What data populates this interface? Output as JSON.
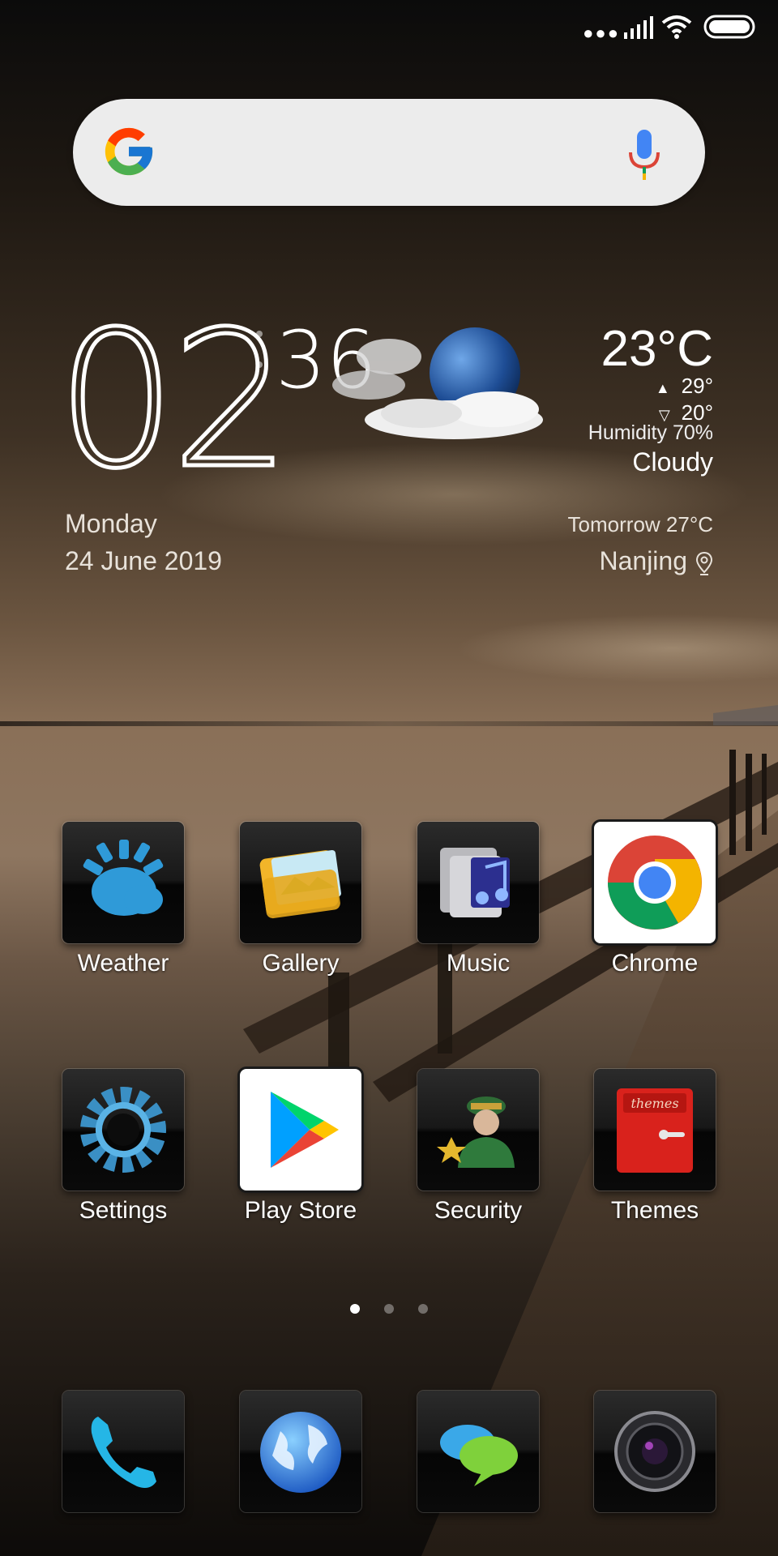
{
  "status_bar": {
    "icons": [
      "dots-icon",
      "signal-icon",
      "wifi-icon",
      "battery-icon"
    ]
  },
  "search": {
    "logo": "google-logo",
    "mic": "mic-icon"
  },
  "clock": {
    "hours": "02",
    "minutes": "36",
    "day": "Monday",
    "date": "24 June 2019"
  },
  "weather": {
    "temperature": "23°C",
    "high": "29°",
    "low": "20°",
    "humidity": "Humidity 70%",
    "condition": "Cloudy",
    "tomorrow": "Tomorrow 27°C",
    "city": "Nanjing"
  },
  "apps": [
    {
      "label": "Weather",
      "icon": "weather-sun-icon"
    },
    {
      "label": "Gallery",
      "icon": "gallery-folder-icon"
    },
    {
      "label": "Music",
      "icon": "music-folder-icon"
    },
    {
      "label": "Chrome",
      "icon": "chrome-icon"
    },
    {
      "label": "Settings",
      "icon": "gear-icon"
    },
    {
      "label": "Play Store",
      "icon": "play-store-icon"
    },
    {
      "label": "Security",
      "icon": "security-guard-icon"
    },
    {
      "label": "Themes",
      "icon": "themes-icon"
    }
  ],
  "pager": {
    "pages": 3,
    "active": 0
  },
  "dock": [
    {
      "icon": "phone-icon"
    },
    {
      "icon": "browser-globe-icon"
    },
    {
      "icon": "messaging-icon"
    },
    {
      "icon": "camera-icon"
    }
  ],
  "colors": {
    "accent_blue": "#2aa7e0",
    "chrome_red": "#db4437",
    "chrome_yellow": "#f4b400",
    "chrome_green": "#0f9d58",
    "chrome_blue": "#4285f4"
  }
}
